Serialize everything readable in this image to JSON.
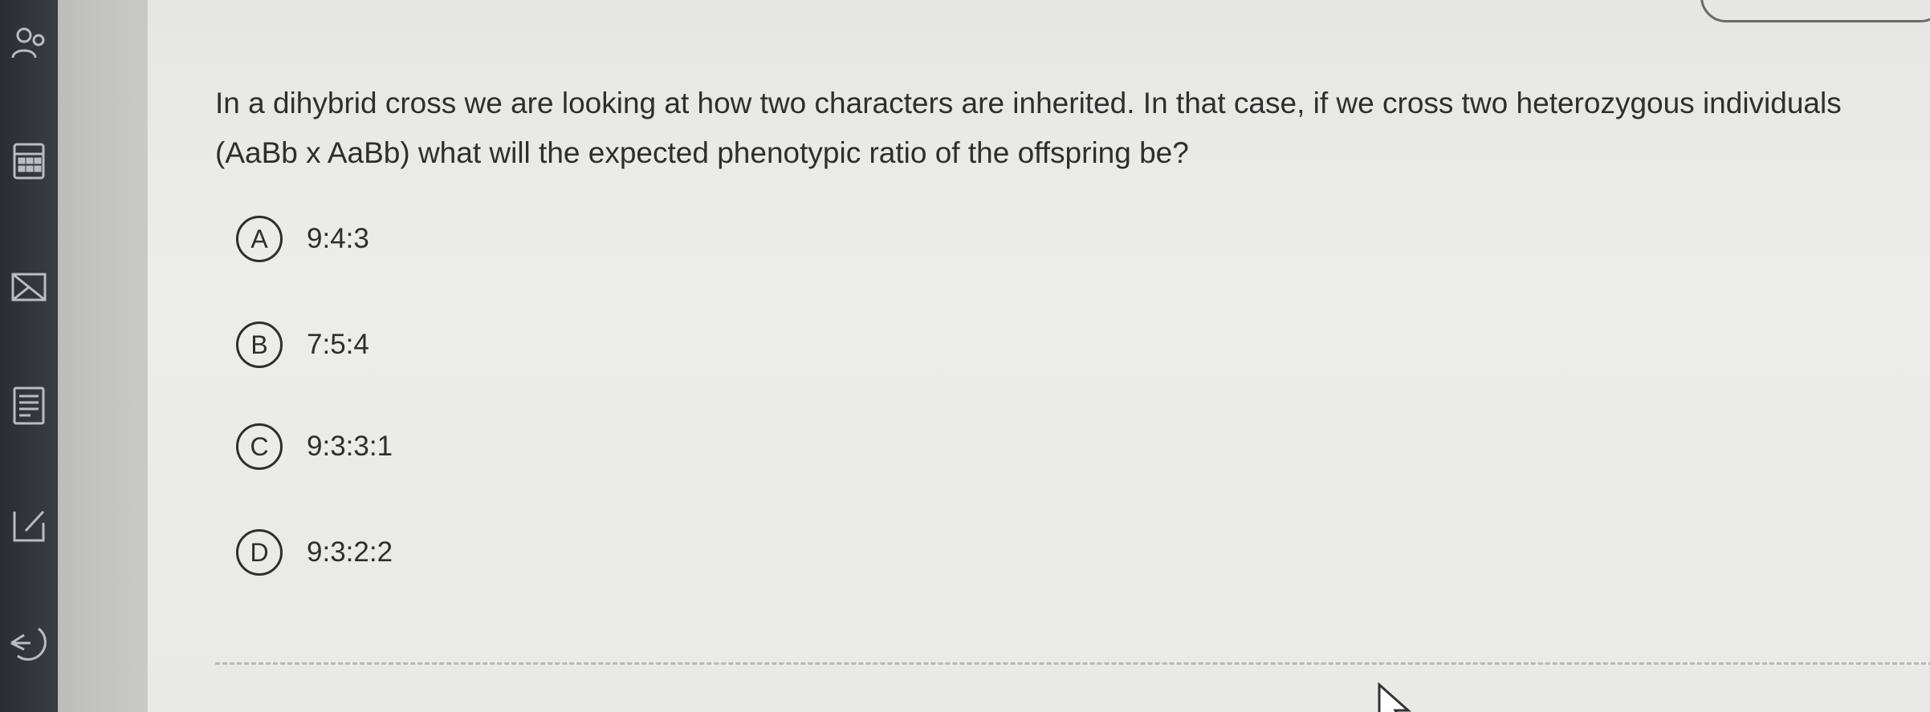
{
  "question": {
    "text": "In a dihybrid cross we are looking at how two characters are inherited. In that case, if we cross two heterozygous individuals (AaBb x AaBb) what will the expected phenotypic ratio of the offspring be?"
  },
  "options": [
    {
      "letter": "A",
      "text": "9:4:3"
    },
    {
      "letter": "B",
      "text": "7:5:4"
    },
    {
      "letter": "C",
      "text": "9:3:3:1"
    },
    {
      "letter": "D",
      "text": "9:3:2:2"
    }
  ],
  "rail": {
    "icons": [
      "people-icon",
      "calculator-icon",
      "flag-icon",
      "notes-icon",
      "edit-icon",
      "back-icon"
    ]
  },
  "colors": {
    "rail": "#2f3236",
    "gutter": "#c4c4c2",
    "content": "#e9e9e7",
    "text": "#2e2e2e"
  }
}
